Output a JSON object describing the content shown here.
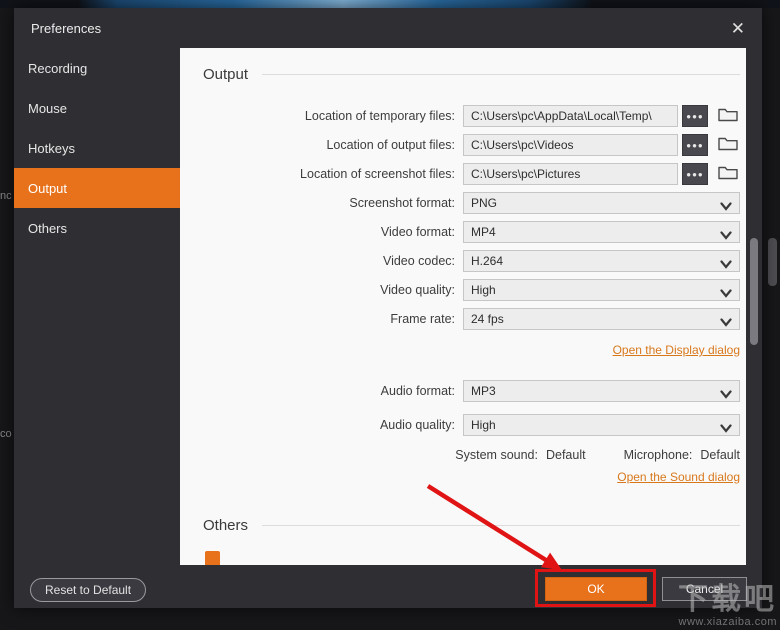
{
  "window": {
    "title": "Preferences",
    "close_glyph": "✕"
  },
  "background": {
    "fragments": [
      "nc",
      "co"
    ]
  },
  "sidebar": {
    "items": [
      {
        "label": "Recording",
        "selected": false
      },
      {
        "label": "Mouse",
        "selected": false
      },
      {
        "label": "Hotkeys",
        "selected": false
      },
      {
        "label": "Output",
        "selected": true
      },
      {
        "label": "Others",
        "selected": false
      }
    ]
  },
  "output_section": {
    "heading": "Output",
    "browse_glyph": "●●●",
    "path_rows": [
      {
        "label": "Location of temporary files:",
        "value": "C:\\Users\\pc\\AppData\\Local\\Temp\\"
      },
      {
        "label": "Location of output files:",
        "value": "C:\\Users\\pc\\Videos"
      },
      {
        "label": "Location of screenshot files:",
        "value": "C:\\Users\\pc\\Pictures"
      }
    ],
    "dropdown_rows": [
      {
        "label": "Screenshot format:",
        "value": "PNG"
      },
      {
        "label": "Video format:",
        "value": "MP4"
      },
      {
        "label": "Video codec:",
        "value": "H.264"
      },
      {
        "label": "Video quality:",
        "value": "High"
      },
      {
        "label": "Frame rate:",
        "value": "24 fps"
      }
    ],
    "display_link": "Open the Display dialog",
    "audio_rows": [
      {
        "label": "Audio format:",
        "value": "MP3"
      },
      {
        "label": "Audio quality:",
        "value": "High"
      }
    ],
    "sound_row": {
      "system_label": "System sound:",
      "system_value": "Default",
      "mic_label": "Microphone:",
      "mic_value": "Default"
    },
    "sound_link": "Open the Sound dialog"
  },
  "others_section": {
    "heading": "Others"
  },
  "footer": {
    "reset_label": "Reset to Default",
    "ok_label": "OK",
    "cancel_label": "Cancel"
  },
  "watermark": {
    "line1": "下载吧",
    "line2": "www.xiazaiba.com"
  },
  "colors": {
    "accent": "#e8721c",
    "annotation_red": "#e01414",
    "link": "#d8781c"
  }
}
